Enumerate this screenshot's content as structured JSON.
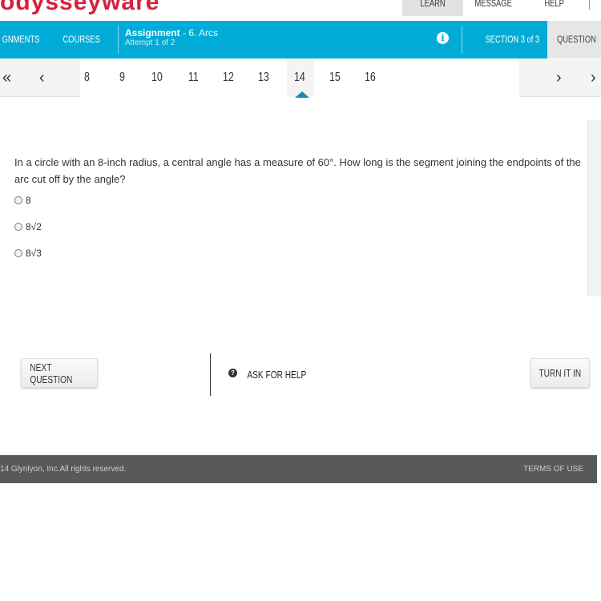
{
  "brand": {
    "logo": "odysseyware",
    "color": "#d81e3a",
    "accent": "#00acd7"
  },
  "top_nav": {
    "learn": "LEARN",
    "message": "MESSAGE",
    "help": "HELP"
  },
  "header": {
    "assignments": "GNMENTS",
    "courses": "COURSES",
    "title": "Assignment",
    "subtitle": " - 6. Arcs",
    "attempt": "Attempt 1 of 2",
    "section": "SECTION 3 of 3",
    "question": "QUESTION"
  },
  "pager": {
    "numbers": [
      "8",
      "9",
      "10",
      "11",
      "12",
      "13",
      "14",
      "15",
      "16"
    ],
    "current": "14"
  },
  "question": {
    "text": "In a circle with an 8-inch radius, a central angle has a measure of 60°. How long is the segment joining the endpoints of the arc cut off by the angle?",
    "options": [
      "8",
      "8√2",
      "8√3"
    ]
  },
  "actions": {
    "next": "NEXT QUESTION",
    "help": "ASK FOR HELP",
    "turn_in": "TURN IT IN"
  },
  "footer": {
    "copyright": "14 Glynlyon, Inc.All rights reserved.",
    "terms": "TERMS OF USE"
  }
}
